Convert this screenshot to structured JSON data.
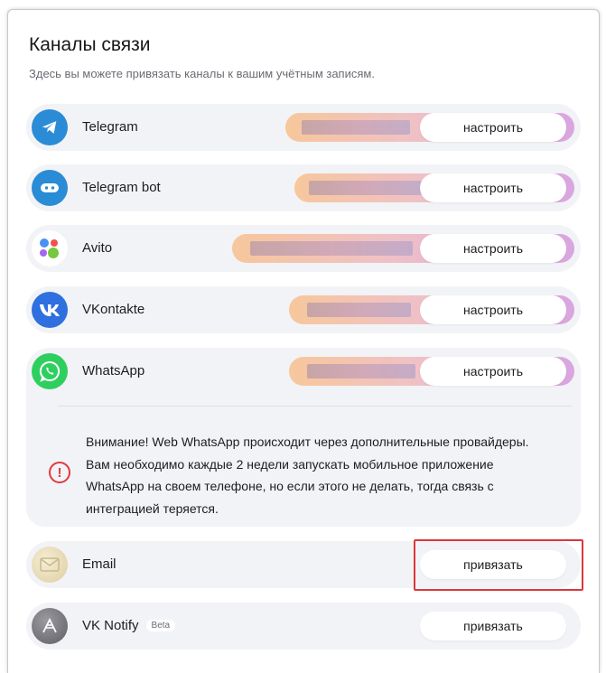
{
  "header": {
    "title": "Каналы связи",
    "subtitle": "Здесь вы можете привязать каналы к вашим учётным записям."
  },
  "channels": [
    {
      "name": "Telegram",
      "icon": "telegram-icon",
      "action_label": "настроить",
      "connected": true
    },
    {
      "name": "Telegram bot",
      "icon": "telegram-bot-icon",
      "action_label": "настроить",
      "connected": true
    },
    {
      "name": "Avito",
      "icon": "avito-icon",
      "action_label": "настроить",
      "connected": true
    },
    {
      "name": "VKontakte",
      "icon": "vk-icon",
      "action_label": "настроить",
      "connected": true
    },
    {
      "name": "WhatsApp",
      "icon": "whatsapp-icon",
      "action_label": "настроить",
      "connected": true
    },
    {
      "name": "Email",
      "icon": "email-icon",
      "action_label": "привязать",
      "connected": false
    },
    {
      "name": "VK Notify",
      "badge": "Beta",
      "icon": "vk-notify-icon",
      "action_label": "привязать",
      "connected": false
    }
  ],
  "warning": {
    "icon": "alert-icon",
    "text": "Внимание! Web WhatsApp происходит через дополнительные провайдеры. Вам необходимо каждые 2 недели запускать мобильное приложение WhatsApp на своем телефоне, но если этого не делать, тогда связь с интеграцией теряется."
  },
  "colors": {
    "telegram": "#2a8bd6",
    "vk": "#2f6fe0",
    "whatsapp": "#2fcf5f",
    "alert": "#e0393e",
    "highlight": "#d9383a",
    "row_bg": "#f2f3f6"
  }
}
